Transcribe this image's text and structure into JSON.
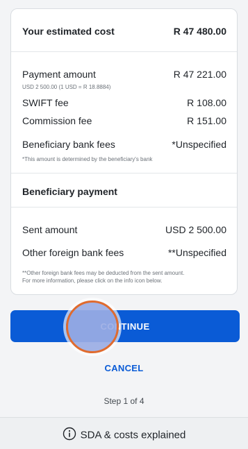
{
  "estimate": {
    "label": "Your estimated cost",
    "value": "R 47 480.00"
  },
  "payment": {
    "label": "Payment amount",
    "value": "R 47 221.00",
    "note": "USD 2 500.00 (1 USD = R 18.8884)"
  },
  "swift": {
    "label": "SWIFT fee",
    "value": "R 108.00"
  },
  "commission": {
    "label": "Commission fee",
    "value": "R 151.00"
  },
  "beneficiary_bank": {
    "label": "Beneficiary bank fees",
    "value": "*Unspecified",
    "note": "*This amount is determined by the beneficiary's bank"
  },
  "beneficiary_payment": {
    "heading": "Beneficiary payment"
  },
  "sent": {
    "label": "Sent amount",
    "value": "USD 2 500.00"
  },
  "foreign": {
    "label": "Other foreign bank fees",
    "value": "**Unspecified",
    "note_line1": "**Other foreign bank fees may be deducted from the sent amount.",
    "note_line2": "For more information, please click on the info icon below."
  },
  "buttons": {
    "continue": "CONTINUE",
    "cancel": "CANCEL"
  },
  "step": "Step 1 of 4",
  "footer": {
    "label": "SDA & costs explained",
    "icon": "info-icon"
  },
  "colors": {
    "primary": "#0a5bd6",
    "touch_ring": "#e06b2e"
  }
}
